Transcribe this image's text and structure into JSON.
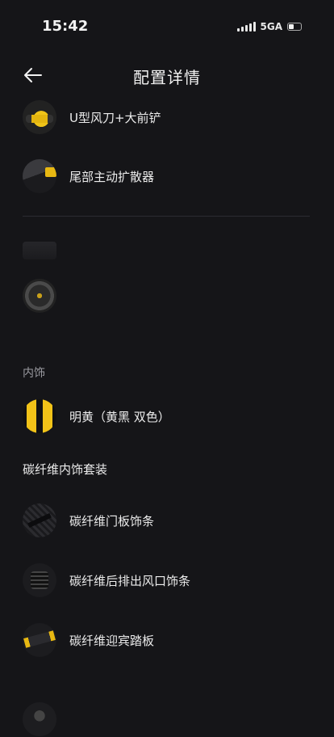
{
  "status": {
    "time": "15:42",
    "network": "5GA"
  },
  "header": {
    "title": "配置详情"
  },
  "exterior": {
    "items": [
      {
        "label": "U型风刀+大前铲",
        "icon": "front-spoiler-thumb"
      },
      {
        "label": "尾部主动扩散器",
        "icon": "rear-diffuser-thumb"
      }
    ]
  },
  "interior": {
    "section_title": "内饰",
    "color_item": {
      "label": "明黄（黄黑 双色）",
      "icon": "yellow-black-swatch"
    },
    "carbon_group_title": "碳纤维内饰套装",
    "carbon_items": [
      {
        "label": "碳纤维门板饰条",
        "icon": "door-trim-thumb"
      },
      {
        "label": "碳纤维后排出风口饰条",
        "icon": "rear-vent-thumb"
      },
      {
        "label": "碳纤维迎宾踏板",
        "icon": "sill-plate-thumb"
      }
    ]
  },
  "colors": {
    "background": "#151518",
    "accent": "#f2c318",
    "text": "#ececec",
    "muted": "#9a9aa0"
  }
}
